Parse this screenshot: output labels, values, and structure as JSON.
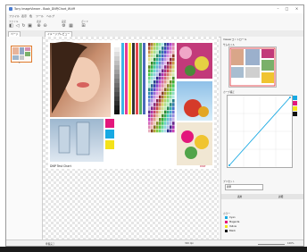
{
  "window": {
    "title": "Tony ImageViewer - Book_DNPJChart_W.tiff"
  },
  "menubar": {
    "items": [
      "ファイル",
      "表示",
      "色",
      "ツール",
      "ヘルプ"
    ]
  },
  "toolbar": {
    "groups": [
      "ファイル",
      "表示",
      "設定",
      "ガイド"
    ]
  },
  "tabs": {
    "left": "ページ",
    "main": "イメージプレビュー"
  },
  "sidebar": {
    "page_number": "1"
  },
  "right_panel": {
    "viewer_title": "Viewerコントロール",
    "thumb_header": "サムネイル",
    "curve_header": "カーブ補正",
    "preset_label": "プリセット",
    "preset_value": "標準",
    "buttons": [
      "適用",
      "詳細"
    ],
    "colorlist_header": "カラー",
    "colors": [
      {
        "name": "Cyan",
        "hex": "#18a9e3"
      },
      {
        "name": "Magenta",
        "hex": "#e3177c"
      },
      {
        "name": "Yellow",
        "hex": "#f4e21a"
      },
      {
        "name": "Black",
        "hex": "#111111"
      }
    ]
  },
  "canvas": {
    "chart_title": "DNP Test Chart",
    "corner_mark": "DNP"
  },
  "statusbar": {
    "left": "準備完了",
    "middle": "300 dpi",
    "right": "100%"
  },
  "accent": "#1a6fd3"
}
